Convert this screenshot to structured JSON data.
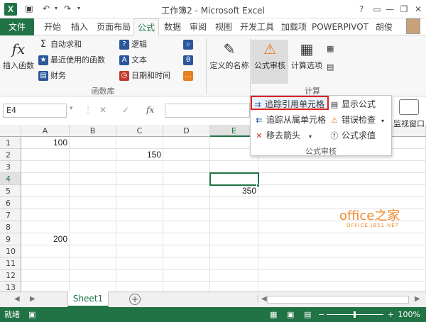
{
  "window": {
    "title": "工作簿2 - Microsoft Excel",
    "help": "?",
    "minimize": "—",
    "restore": "❐",
    "close": "✕"
  },
  "tabs": {
    "file": "文件",
    "items": [
      "开始",
      "插入",
      "页面布局",
      "公式",
      "数据",
      "审阅",
      "视图",
      "开发工具",
      "加载项",
      "POWERPIVOT",
      "胡俊"
    ],
    "active": "公式"
  },
  "ribbon": {
    "insert_function": "插入函数",
    "autosum": "自动求和",
    "recent": "最近使用的函数",
    "financial": "财务",
    "logical": "逻辑",
    "text": "文本",
    "datetime": "日期和时间",
    "defined_names": "定义的名称",
    "formula_auditing": "公式审核",
    "calc_options": "计算选项",
    "group_function_library": "函数库",
    "group_calculation": "计算"
  },
  "formula_bar": {
    "name_box": "E4",
    "fx": "fx",
    "cancel": "✕",
    "enter": "✓"
  },
  "sheet": {
    "columns": [
      "A",
      "B",
      "C",
      "D",
      "E"
    ],
    "rows": [
      "1",
      "2",
      "3",
      "4",
      "5",
      "6",
      "7",
      "8",
      "9",
      "10",
      "11",
      "12",
      "13"
    ],
    "selected_cell": "E4",
    "cells": {
      "A1": "100",
      "C2": "150",
      "E5": "350",
      "A9": "200"
    }
  },
  "auditing_menu": {
    "trace_precedents": "追踪引用单元格",
    "trace_dependents": "追踪从属单元格",
    "remove_arrows": "移去箭头",
    "show_formulas": "显示公式",
    "error_checking": "错误检查",
    "evaluate_formula": "公式求值",
    "group_label": "公式审核",
    "watch_window": "监视窗口"
  },
  "watermark": {
    "line1": "office之家",
    "line2": "OFFICE.JB51.NET"
  },
  "sheet_tabs": {
    "active": "Sheet1",
    "add": "+"
  },
  "status": {
    "ready": "就绪",
    "zoom": "100%"
  },
  "colors": {
    "brand": "#217346",
    "highlight_border": "#e02020"
  }
}
